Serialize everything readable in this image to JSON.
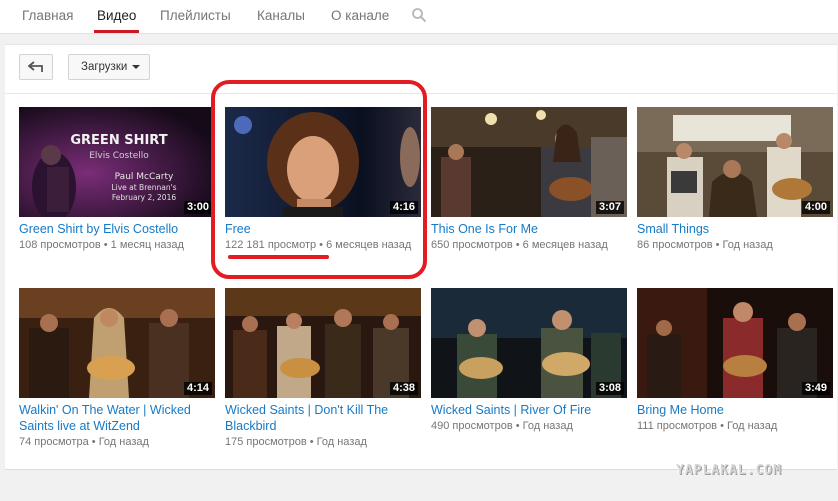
{
  "nav": {
    "tabs": [
      {
        "label": "Главная"
      },
      {
        "label": "Видео"
      },
      {
        "label": "Плейлисты"
      },
      {
        "label": "Каналы"
      },
      {
        "label": "О канале"
      }
    ],
    "active_tab": "Видео",
    "search_icon": "search-icon"
  },
  "toolbar": {
    "back_icon": "back-arrow-icon",
    "dropdown_label": "Загрузки",
    "dropdown_icon": "caret-down-icon"
  },
  "videos": [
    {
      "title": "Green Shirt by Elvis Costello",
      "views": "108 просмотров",
      "age": "1 месяц назад",
      "duration": "3:00",
      "thumb_text": {
        "line1": "GREEN SHIRT",
        "line2": "Elvis Costello",
        "line3": "Paul McCarty",
        "line4": "Live at Brennan's",
        "line5": "February 2, 2016"
      }
    },
    {
      "title": "Free",
      "views": "122 181 просмотр",
      "age": "6 месяцев назад",
      "duration": "4:16"
    },
    {
      "title": "This One Is For Me",
      "views": "650 просмотров",
      "age": "6 месяцев назад",
      "duration": "3:07"
    },
    {
      "title": "Small Things",
      "views": "86 просмотров",
      "age": "Год назад",
      "duration": "4:00"
    },
    {
      "title": "Walkin' On The Water | Wicked Saints live at WitZend",
      "views": "74 просмотра",
      "age": "Год назад",
      "duration": "4:14"
    },
    {
      "title": "Wicked Saints | Don't Kill The Blackbird",
      "views": "175 просмотров",
      "age": "Год назад",
      "duration": "4:38"
    },
    {
      "title": "Wicked Saints | River Of Fire",
      "views": "490 просмотров",
      "age": "Год назад",
      "duration": "3:08"
    },
    {
      "title": "Bring Me Home",
      "views": "111 просмотров",
      "age": "Год назад",
      "duration": "3:49"
    }
  ],
  "meta_separator": "•",
  "watermark": "YAPLAKAL.COM",
  "colors": {
    "accent_red": "#cc181e",
    "link_blue": "#167ac6",
    "annotation_red": "#e31b23"
  }
}
